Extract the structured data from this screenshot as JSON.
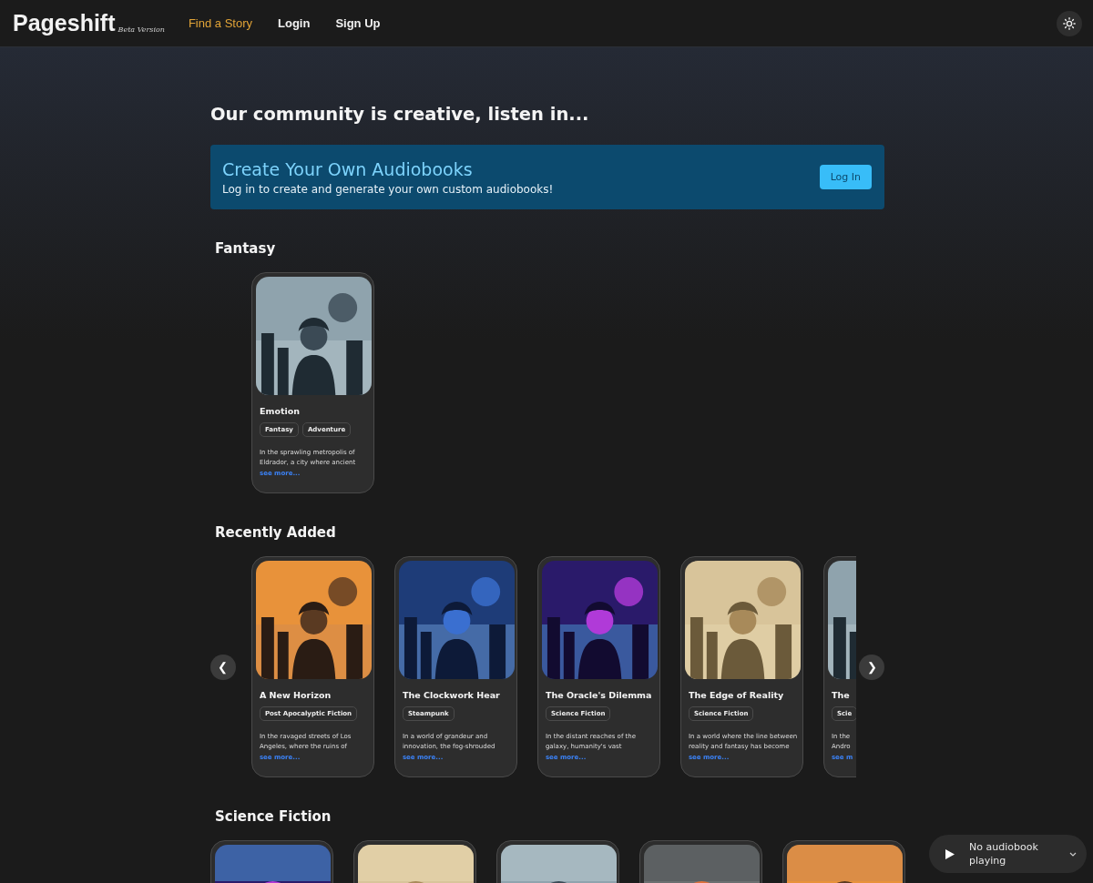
{
  "header": {
    "logo": "Pageshift",
    "logo_tag": "Beta Version",
    "nav": [
      {
        "label": "Find a Story",
        "selected": true
      },
      {
        "label": "Login",
        "selected": false
      },
      {
        "label": "Sign Up",
        "selected": false
      }
    ]
  },
  "heading": "Our community is creative, listen in...",
  "banner": {
    "title": "Create Your Own Audiobooks",
    "text": "Log in to create and generate your own custom audiobooks!",
    "button": "Log In"
  },
  "sections": [
    {
      "title": "Fantasy",
      "carousel": false,
      "cards": [
        {
          "kind": "story",
          "title": "Emotion",
          "tags": [
            "Fantasy",
            "Adventure"
          ],
          "description": [
            "In the sprawling metropolis of",
            "Eldrador, a city where ancient"
          ],
          "link": "see more..."
        }
      ]
    },
    {
      "title": "Recently Added",
      "carousel": true,
      "prev": "❮",
      "next": "❯",
      "cards": [
        {
          "kind": "story",
          "title": "A New Horizon",
          "tags": [
            "Post Apocalyptic Fiction"
          ],
          "description": [
            "In the ravaged streets of Los",
            "Angeles, where the ruins of"
          ],
          "link": "see more..."
        },
        {
          "kind": "story",
          "title": "The Clockwork Hear",
          "tags": [
            "Steampunk"
          ],
          "description": [
            "In a world of grandeur and",
            "innovation, the fog-shrouded"
          ],
          "link": "see more..."
        },
        {
          "kind": "story",
          "title": "The Oracle's Dilemma",
          "tags": [
            "Science Fiction"
          ],
          "description": [
            "In the distant reaches of the",
            "galaxy, humanity's vast"
          ],
          "link": "see more..."
        },
        {
          "kind": "story",
          "title": "The Edge of Reality",
          "tags": [
            "Science Fiction"
          ],
          "description": [
            "In a world where the line between",
            "reality and fantasy has become"
          ],
          "link": "see more..."
        },
        {
          "kind": "story",
          "title": "The",
          "tags": [
            "Scie"
          ],
          "description": [
            "In the",
            "Andro"
          ],
          "link": "see m"
        }
      ]
    },
    {
      "title": "Science Fiction",
      "carousel": false
    }
  ],
  "player": {
    "status": "No audiobook playing"
  }
}
